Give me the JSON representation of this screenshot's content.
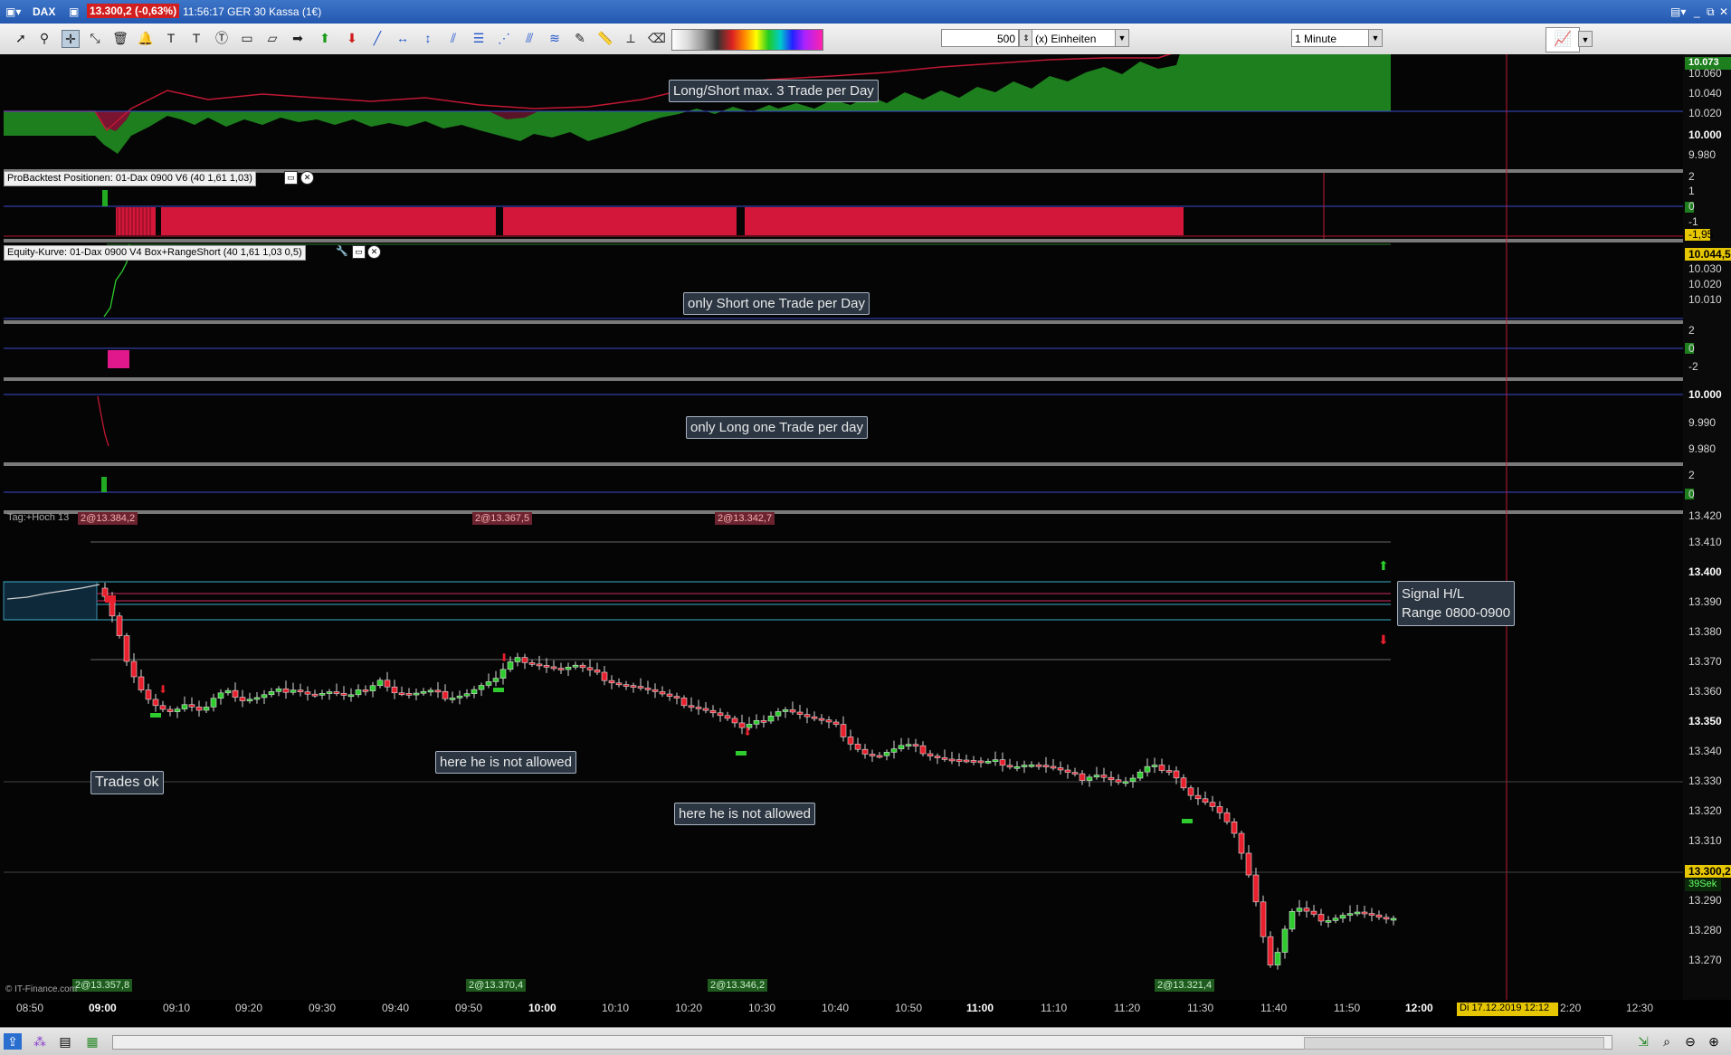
{
  "titlebar": {
    "instrument": "DAX",
    "price": "13.300,2 (-0,63%)",
    "info": "11:56:17 GER 30 Kassa (1€)"
  },
  "toolbar": {
    "quantity": "500",
    "units": "(x) Einheiten",
    "timeframe": "1 Minute"
  },
  "panels": {
    "backtest_label": "ProBacktest Positionen: 01-Dax 0900  V6 (40 1,61 1,03)",
    "equity_label": "Equity-Kurve: 01-Dax 0900  V4 Box+RangeShort (40 1,61 1,03 0,5)",
    "main_label": "Tag:+Hoch 13"
  },
  "annotations": {
    "a1": "Long/Short max. 3 Trade per Day",
    "a2": "only Short one Trade per Day",
    "a3": "only Long one Trade per day",
    "a4": "Trades ok",
    "a5": "here he is not allowed",
    "a6": "here he is not allowed",
    "a7a": "Signal H/L",
    "a7b": "Range 0800-0900"
  },
  "tags": {
    "r1": "2@13.367,5",
    "r2": "2@13.342,7",
    "r0": "2@13.384,2",
    "g0": "2@13.357,8",
    "g1": "2@13.370,4",
    "g2": "2@13.346,2",
    "g3": "2@13.321,4"
  },
  "y_axes": {
    "p1": [
      "10.073",
      "10.060",
      "10.040",
      "10.020",
      "10.000",
      "9.980"
    ],
    "p2": [
      "2",
      "1",
      "0",
      "-1",
      "-1,95"
    ],
    "p3": [
      "10.044,5",
      "10.030",
      "10.020",
      "10.010"
    ],
    "p4": [
      "2",
      "0",
      "-2"
    ],
    "p5": [
      "10.000",
      "9.990",
      "9.980"
    ],
    "p6": [
      "2",
      "0"
    ],
    "main": [
      "13.420",
      "13.410",
      "13.400",
      "13.390",
      "13.380",
      "13.370",
      "13.360",
      "13.350",
      "13.340",
      "13.330",
      "13.320",
      "13.310",
      "13.300,2",
      "13.290",
      "13.280",
      "13.270"
    ],
    "timer": "39Sek"
  },
  "x_axis": [
    "08:50",
    "09:00",
    "09:10",
    "09:20",
    "09:30",
    "09:40",
    "09:50",
    "10:00",
    "10:10",
    "10:20",
    "10:30",
    "10:40",
    "10:50",
    "11:00",
    "11:10",
    "11:20",
    "11:30",
    "11:40",
    "11:50",
    "12:00",
    "2:20",
    "12:30"
  ],
  "cursor_date": "Di 17.12.2019 12:12",
  "copyright": "© IT-Finance.com",
  "colors": {
    "bull": "#2ecc2e",
    "bear": "#e8202e",
    "equity_fill": "#1e7f1e",
    "position_bar": "#d3173a"
  }
}
